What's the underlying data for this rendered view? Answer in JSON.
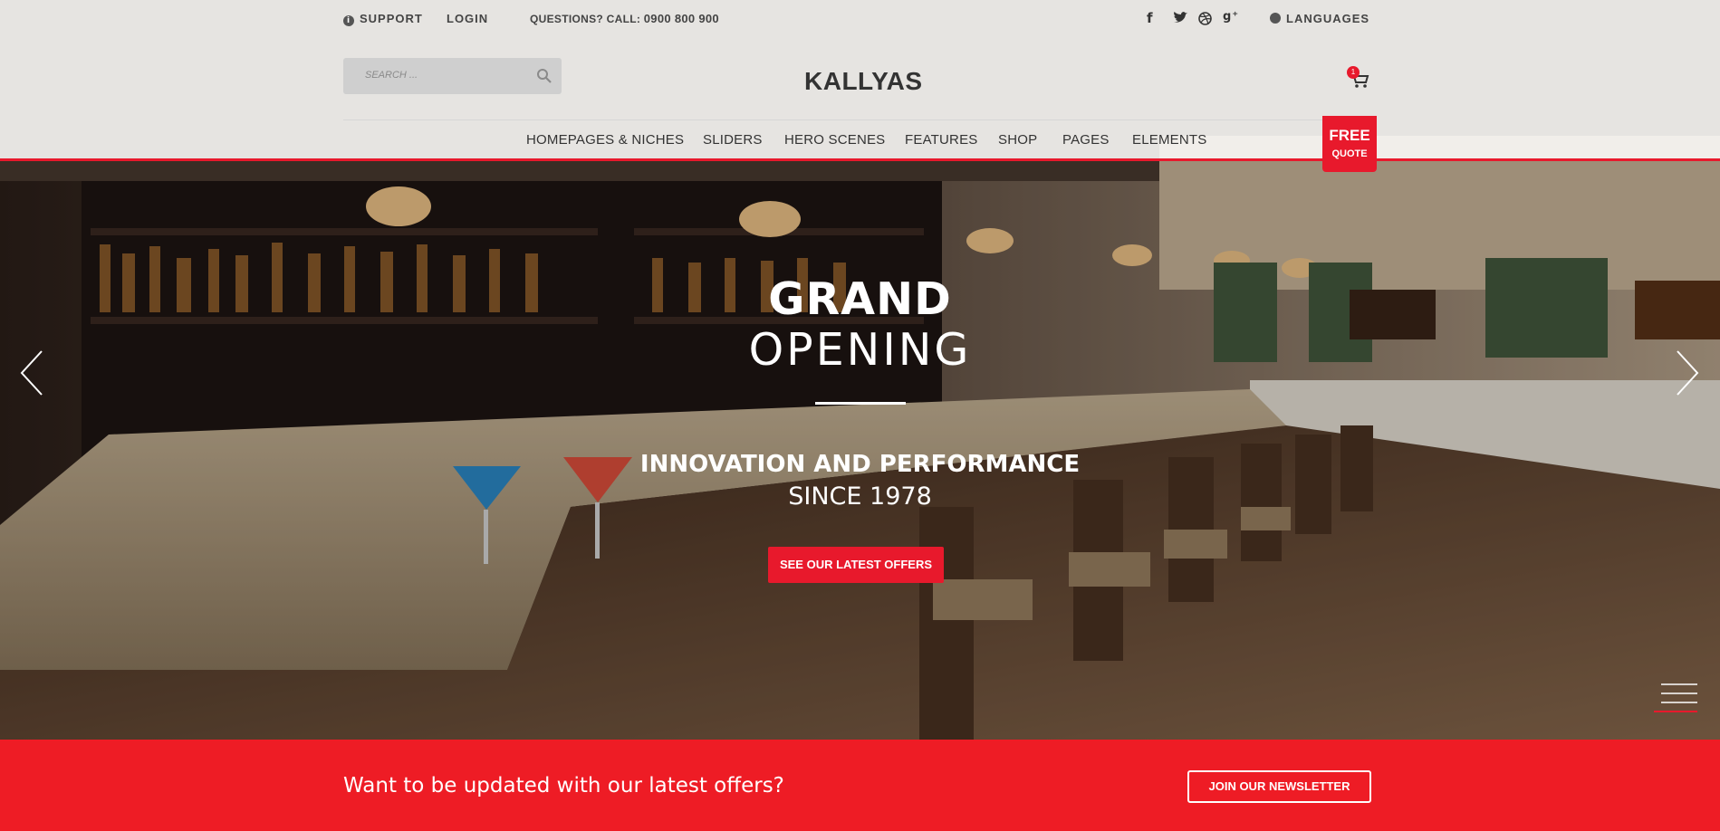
{
  "topbar": {
    "support": "SUPPORT",
    "login": "LOGIN",
    "question_label": "QUESTIONS? CALL:",
    "phone": "0900 800 900",
    "social": [
      "facebook-icon",
      "twitter-icon",
      "dribbble-icon",
      "googleplus-icon"
    ],
    "languages": "LANGUAGES"
  },
  "search": {
    "placeholder": "SEARCH ..."
  },
  "logo": "KALLYAS",
  "cart": {
    "count": "1"
  },
  "nav": {
    "items": [
      "HOMEPAGES & NICHES",
      "SLIDERS",
      "HERO SCENES",
      "FEATURES",
      "SHOP",
      "PAGES",
      "ELEMENTS"
    ]
  },
  "free_quote": {
    "line1": "FREE",
    "line2": "QUOTE"
  },
  "hero": {
    "title_bold": "GRAND",
    "title_light": "OPENING",
    "subtitle_bold": "INNOVATION AND PERFORMANCE",
    "subtitle_light": "SINCE 1978",
    "cta": "SEE OUR LATEST OFFERS"
  },
  "newsletter": {
    "text": "Want to be updated with our latest offers?",
    "button": "JOIN OUR NEWSLETTER"
  },
  "colors": {
    "accent": "#e8192c",
    "newsletter_bg": "#ee1c25",
    "header_bg": "#faf8f6"
  }
}
